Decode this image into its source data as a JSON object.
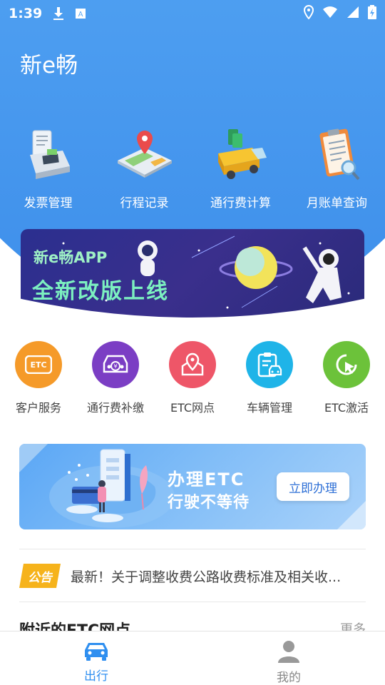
{
  "status_bar": {
    "time": "1:39"
  },
  "app": {
    "title": "新e畅"
  },
  "quick_actions": [
    {
      "label": "发票管理",
      "icon": "invoice-machine-icon"
    },
    {
      "label": "行程记录",
      "icon": "map-pin-icon"
    },
    {
      "label": "通行费计算",
      "icon": "truck-money-icon"
    },
    {
      "label": "月账单查询",
      "icon": "clipboard-search-icon"
    }
  ],
  "banner": {
    "subtitle": "新e畅APP",
    "title": "全新改版上线"
  },
  "services": [
    {
      "label": "客户服务",
      "icon": "etc-card-icon",
      "color": "#f39a2e"
    },
    {
      "label": "通行费补缴",
      "icon": "car-payment-icon",
      "color": "#7a3fc2"
    },
    {
      "label": "ETC网点",
      "icon": "map-location-icon",
      "color": "#ee5a6b"
    },
    {
      "label": "车辆管理",
      "icon": "vehicle-clipboard-icon",
      "color": "#20b3e6"
    },
    {
      "label": "ETC激活",
      "icon": "activate-cursor-icon",
      "color": "#6cc23a"
    }
  ],
  "etc_card": {
    "title": "办理ETC",
    "subtitle": "行驶不等待",
    "button": "立即办理"
  },
  "notice": {
    "badge": "公告",
    "text": "最新！关于调整收费公路收费标准及相关收..."
  },
  "nearby": {
    "title": "附近的ETC网点",
    "more": "更多"
  },
  "tabbar": [
    {
      "label": "出行",
      "active": true
    },
    {
      "label": "我的",
      "active": false
    }
  ]
}
